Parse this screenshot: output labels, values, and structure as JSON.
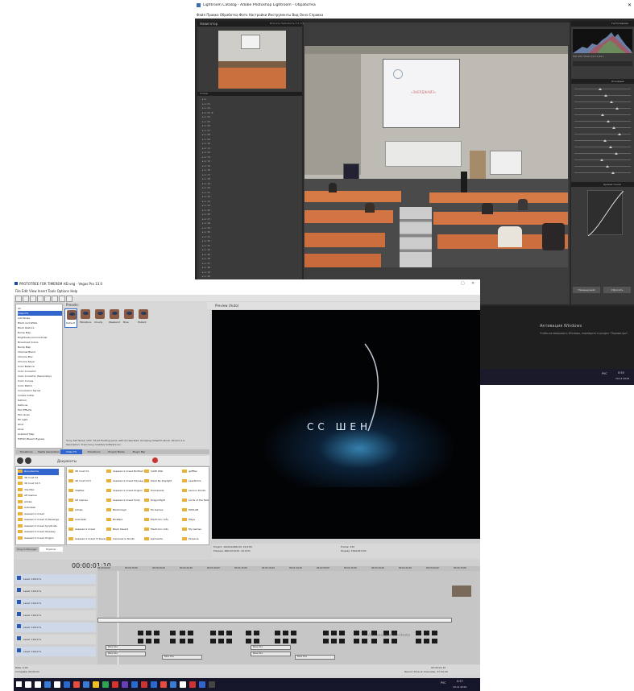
{
  "lightroom": {
    "title": "Lightroom Catalog - Adobe Photoshop Lightroom - Обработка",
    "menu": "Файл  Правка  Обработка  Фото  Настройки  Инструменты  Вид  Окно  Справка",
    "navigator_label": "Навигатор",
    "navigator_zoom": "Вписать   Заполнить  1:1  3:1",
    "presets_label": "Стили",
    "histogram_label": "Гистограмма",
    "histogram_info": "ISO 200   35мм   f/4.5   1/60 с",
    "basic_label": "Основные",
    "tone_curve_label": "Кривая тонов",
    "prev_button": "Предыдущий",
    "reset_button": "Сбросить",
    "activation_title": "Активация Windows",
    "activation_text": "Чтобы активировать Windows, перейдите в раздел \"Параметры\".",
    "tray_time": "0:55",
    "tray_date": "19.11.2019",
    "tray_lang": "РУС",
    "slide_text": "«ЭНЕРДЖАЙЗ»",
    "preset_items": [
      "Lr",
      "Lr 01",
      "Lr 02",
      "Lr 03 ★",
      "Lr 04",
      "Lr 05",
      "Lr 06",
      "Lr 07",
      "Lr 08",
      "Lr 09",
      "Lr 10",
      "Lr 11",
      "Lr 12",
      "Lr 13",
      "Lr 14",
      "Lr 15",
      "Lr 16",
      "Lr 17",
      "Lr 18",
      "Lr 19",
      "Lr 20",
      "Lr 21",
      "Lr 22",
      "Lr 23",
      "Lr 24",
      "Lr 25",
      "Lr 26",
      "Lr 27",
      "Lr 28",
      "Lr 29",
      "Lr 30",
      "Lr 31",
      "Lr 32",
      "Lr 33",
      "Lr 34",
      "Lr 35",
      "Lr 36",
      "Lr 37",
      "Lr 38",
      "Lr 39",
      "Lr 40",
      "Lr 41",
      "Lr 42",
      "Lr 43",
      "Lr 44",
      "Lr 45"
    ]
  },
  "vegas": {
    "title": "PROTOTREE FOR TIMEREM HD.veg - Vegas Pro 13.0",
    "menu": "File  Edit  View  Insert  Tools  Options  Help",
    "fx_tree_header": "Presets:",
    "fx_tree": [
      "All",
      "Video FX",
      "Add Noise",
      "Black and White",
      "Black Restore",
      "Bump Map",
      "Brightness and Contrast",
      "Broadcast Colors",
      "Bump Map",
      "Channel Blend",
      "Chroma Blur",
      "Chroma Keyer",
      "Color Balance",
      "Color Corrector",
      "Color Corrector (Secondary)",
      "Color Curves",
      "Color Match",
      "Convolution Kernel",
      "Cookie Cutter",
      "Deform",
      "Defocus",
      "Film Effects",
      "Film Grain",
      "Fill Light",
      "Glint",
      "Glow",
      "Gradient Map",
      "HitFilm Bleach Bypass"
    ],
    "fx_presets": [
      "Default",
      "Miniature",
      "Cloudy",
      "Weekend",
      "Blue",
      "Mutant"
    ],
    "fx_description": "Sony Add Noise: OFX, 32-bit floating point, GPU Accelerated, Grouping VideoFX.about, Version 1.0",
    "fx_description2": "Description: From Sony Creative Software Inc.",
    "tabs": [
      "Transitions",
      "Media Generators",
      "Video FX",
      "Transitions",
      "Project Media",
      "Plugin Mgr"
    ],
    "explorer_path": "Документы",
    "explorer_tree": [
      "Документы",
      "3D Coat V4",
      "3D Coat V4.5",
      "3ds Max",
      "AH Games",
      "Adobe",
      "Autodesk",
      "Assassin's Creed",
      "Assassin's Creed IV Revenge",
      "Assassin's Creed Syndicate",
      "Assassin's Creed Odyssey",
      "Assassin's Creed Origins"
    ],
    "explorer_files": [
      [
        "3D Coat V4",
        "Assassin's Creed Brotherhood",
        "CAVE Wiki",
        "gaffiter"
      ],
      [
        "3D Coat V4.5",
        "Assassin's Creed Odyssey",
        "Dead By Daylight",
        "LessTerms"
      ],
      [
        "3dsMax",
        "Assassin's Creed Origins",
        "Downloads",
        "Lenovo Studio"
      ],
      [
        "AH Games",
        "Assassin's Creed Unity",
        "Dragonfight",
        "Lords of the Fallen"
      ],
      [
        "Adobe",
        "Blackmagic",
        "EA Games",
        "MATLAB"
      ],
      [
        "Autodesk",
        "BioWare",
        "Electronic Arts",
        "Maya"
      ],
      [
        "Assassin's Creed",
        "Black Desert",
        "Electronic Arts",
        "My Games"
      ],
      [
        "Assassin's Creed IV Revenge",
        "Cameras & Studio",
        "GameArts",
        "Pinnacle"
      ]
    ],
    "bottom_tabs": [
      "Plug-In Manager",
      "Explorer"
    ],
    "preview_toolbar": "Preview (Auto)",
    "preview_title": "CC  ШЕН",
    "project_label": "Project: 1920x1080x32, 29.970i",
    "preview_label": "Preview: 480x270x32, 29.970i",
    "frame_label": "Frame: 332",
    "display_label": "Display: 509x287x32",
    "timecode": "00:00:01;10",
    "ruler": [
      "00:00:00;00",
      "00:00:15;00",
      "00:00:29;29",
      "00:00:44;29",
      "00:01:00;00",
      "00:01:15;00",
      "00:01:29;29",
      "00:01:44;29",
      "00:02:00;00",
      "00:02:15;00",
      "00:02:29;29",
      "00:02:44;29",
      "00:03:00;00",
      "00:03:15;00"
    ],
    "track_labels": [
      "Level: 100.0 %",
      "Level: 100.0 %",
      "Level: 100.0 %",
      "Level: 100.0 %",
      "Level: 100.0 %",
      "Level: 100.0 %",
      "Level: 100.0 %"
    ],
    "rate_label": "Rate: 0.00",
    "complete_label": "Complete: 00:00:01",
    "end_time": "00:00:01;10",
    "record_time": "Record Time (2 channels): 37:32:20",
    "clip_name": "Bass 01a",
    "activation_title": "Активация Windows",
    "activation_text": "Чтобы активировать Windows, перейдите в раздел \"Параметры\".",
    "tray_time": "0:57",
    "tray_date": "19.11.2019",
    "tray_lang": "РУС"
  },
  "colors": {
    "vegas_taskbar": "#16162a",
    "lr_bg": "#282828",
    "folder": "#e8b23a"
  }
}
